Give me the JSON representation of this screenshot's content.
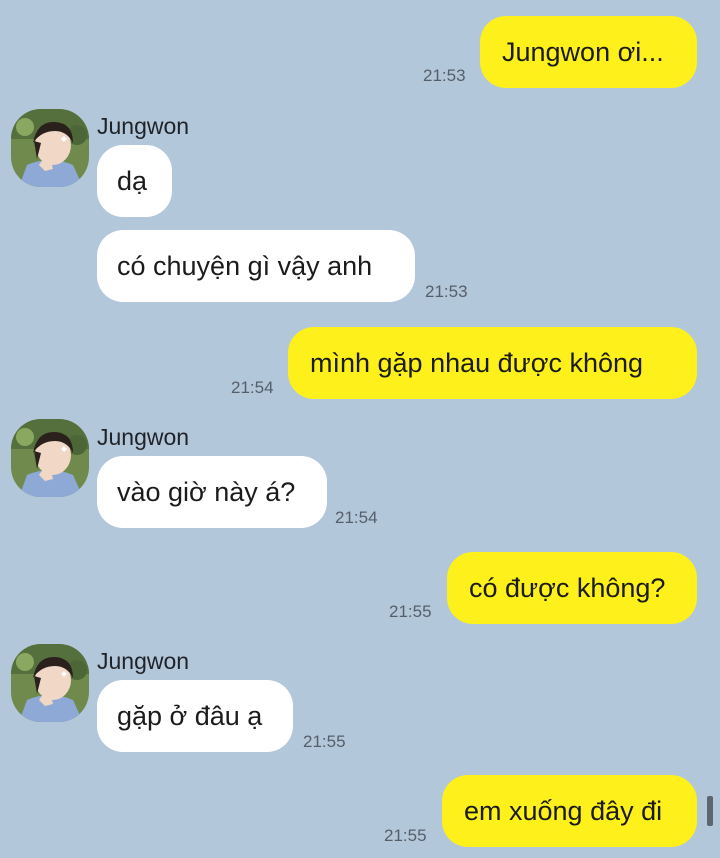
{
  "contact": {
    "name": "Jungwon"
  },
  "messages": [
    {
      "sender": "me",
      "text": "Jungwon ơi...",
      "time": "21:53"
    },
    {
      "sender": "them",
      "text": "dạ"
    },
    {
      "sender": "them",
      "text": "có chuyện gì vậy anh",
      "time": "21:53"
    },
    {
      "sender": "me",
      "text": "mình gặp nhau được không",
      "time": "21:54"
    },
    {
      "sender": "them",
      "text": "vào giờ này á?",
      "time": "21:54"
    },
    {
      "sender": "me",
      "text": "có được không?",
      "time": "21:55"
    },
    {
      "sender": "them",
      "text": "gặp ở đâu ạ",
      "time": "21:55"
    },
    {
      "sender": "me",
      "text": "em xuống đây đi",
      "time": "21:55"
    }
  ],
  "colors": {
    "background": "#b3c7da",
    "outgoing_bubble": "#fef01b",
    "incoming_bubble": "#ffffff",
    "timestamp": "#555f6a"
  }
}
